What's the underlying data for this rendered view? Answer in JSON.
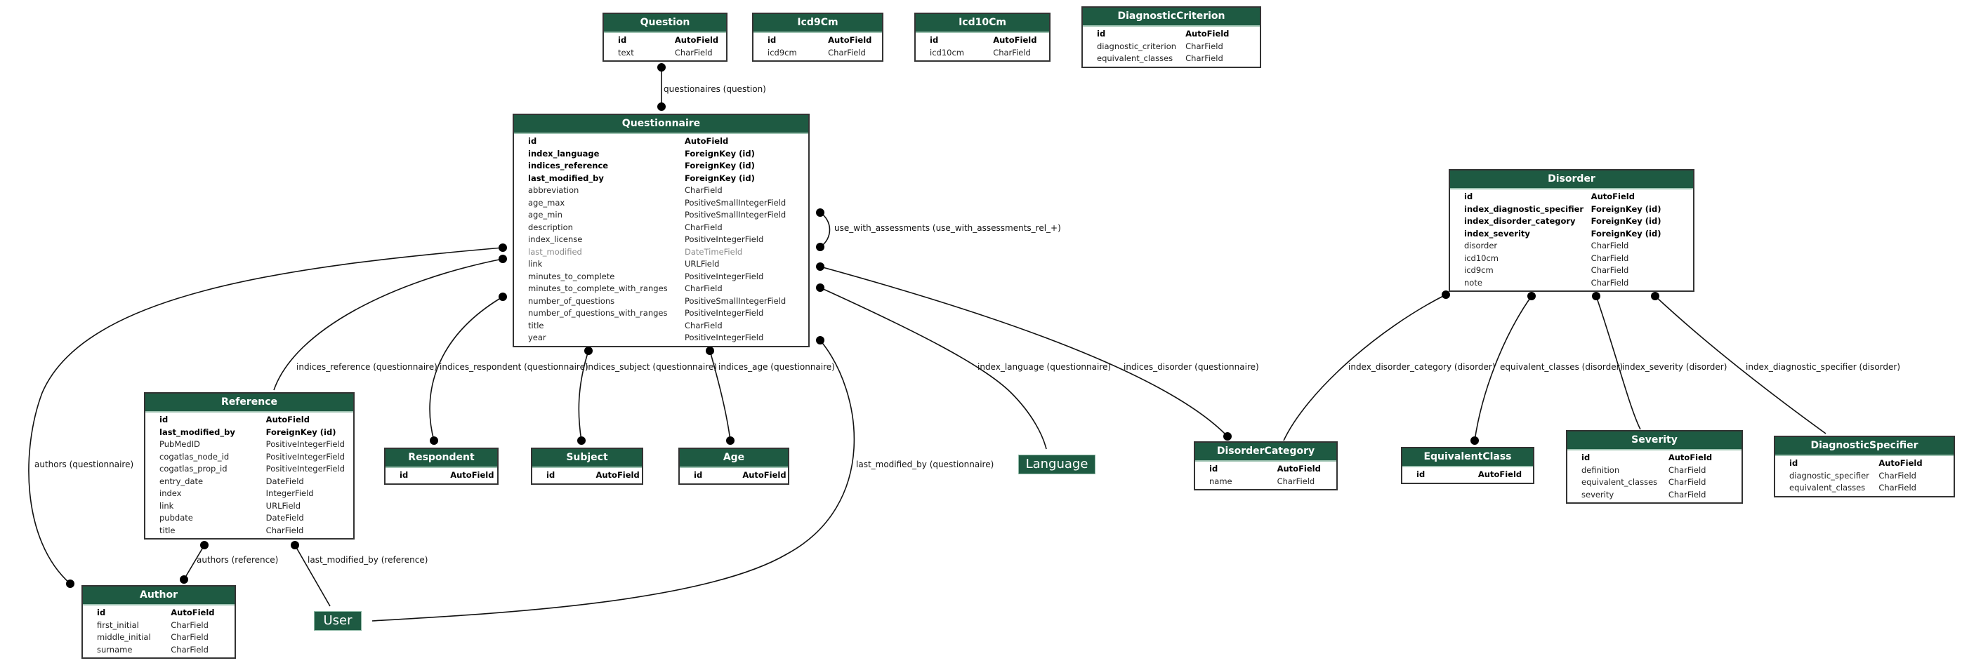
{
  "models": {
    "question": {
      "name": "Question",
      "fields": [
        [
          "id",
          "AutoField",
          "pk"
        ],
        [
          "text",
          "CharField",
          ""
        ]
      ]
    },
    "icd9cm": {
      "name": "Icd9Cm",
      "fields": [
        [
          "id",
          "AutoField",
          "pk"
        ],
        [
          "icd9cm",
          "CharField",
          ""
        ]
      ]
    },
    "icd10cm": {
      "name": "Icd10Cm",
      "fields": [
        [
          "id",
          "AutoField",
          "pk"
        ],
        [
          "icd10cm",
          "CharField",
          ""
        ]
      ]
    },
    "diagnosticcriterion": {
      "name": "DiagnosticCriterion",
      "fields": [
        [
          "id",
          "AutoField",
          "pk"
        ],
        [
          "diagnostic_criterion",
          "CharField",
          ""
        ],
        [
          "equivalent_classes",
          "CharField",
          ""
        ]
      ]
    },
    "questionnaire": {
      "name": "Questionnaire",
      "fields": [
        [
          "id",
          "AutoField",
          "pk"
        ],
        [
          "index_language",
          "ForeignKey (id)",
          "fk"
        ],
        [
          "indices_reference",
          "ForeignKey (id)",
          "fk"
        ],
        [
          "last_modified_by",
          "ForeignKey (id)",
          "fk"
        ],
        [
          "abbreviation",
          "CharField",
          ""
        ],
        [
          "age_max",
          "PositiveSmallIntegerField",
          ""
        ],
        [
          "age_min",
          "PositiveSmallIntegerField",
          ""
        ],
        [
          "description",
          "CharField",
          ""
        ],
        [
          "index_license",
          "PositiveIntegerField",
          ""
        ],
        [
          "last_modified",
          "DateTimeField",
          "muted"
        ],
        [
          "link",
          "URLField",
          ""
        ],
        [
          "minutes_to_complete",
          "PositiveIntegerField",
          ""
        ],
        [
          "minutes_to_complete_with_ranges",
          "CharField",
          ""
        ],
        [
          "number_of_questions",
          "PositiveSmallIntegerField",
          ""
        ],
        [
          "number_of_questions_with_ranges",
          "PositiveIntegerField",
          ""
        ],
        [
          "title",
          "CharField",
          ""
        ],
        [
          "year",
          "PositiveIntegerField",
          ""
        ]
      ]
    },
    "disorder": {
      "name": "Disorder",
      "fields": [
        [
          "id",
          "AutoField",
          "pk"
        ],
        [
          "index_diagnostic_specifier",
          "ForeignKey (id)",
          "fk"
        ],
        [
          "index_disorder_category",
          "ForeignKey (id)",
          "fk"
        ],
        [
          "index_severity",
          "ForeignKey (id)",
          "fk"
        ],
        [
          "disorder",
          "CharField",
          ""
        ],
        [
          "icd10cm",
          "CharField",
          ""
        ],
        [
          "icd9cm",
          "CharField",
          ""
        ],
        [
          "note",
          "CharField",
          ""
        ]
      ]
    },
    "reference": {
      "name": "Reference",
      "fields": [
        [
          "id",
          "AutoField",
          "pk"
        ],
        [
          "last_modified_by",
          "ForeignKey (id)",
          "fk"
        ],
        [
          "PubMedID",
          "PositiveIntegerField",
          ""
        ],
        [
          "cogatlas_node_id",
          "PositiveIntegerField",
          ""
        ],
        [
          "cogatlas_prop_id",
          "PositiveIntegerField",
          ""
        ],
        [
          "entry_date",
          "DateField",
          ""
        ],
        [
          "index",
          "IntegerField",
          ""
        ],
        [
          "link",
          "URLField",
          ""
        ],
        [
          "pubdate",
          "DateField",
          ""
        ],
        [
          "title",
          "CharField",
          ""
        ]
      ]
    },
    "respondent": {
      "name": "Respondent",
      "fields": [
        [
          "id",
          "AutoField",
          "pk"
        ]
      ]
    },
    "subject": {
      "name": "Subject",
      "fields": [
        [
          "id",
          "AutoField",
          "pk"
        ]
      ]
    },
    "age": {
      "name": "Age",
      "fields": [
        [
          "id",
          "AutoField",
          "pk"
        ]
      ]
    },
    "disordercategory": {
      "name": "DisorderCategory",
      "fields": [
        [
          "id",
          "AutoField",
          "pk"
        ],
        [
          "name",
          "CharField",
          ""
        ]
      ]
    },
    "equivalentclass": {
      "name": "EquivalentClass",
      "fields": [
        [
          "id",
          "AutoField",
          "pk"
        ]
      ]
    },
    "severity": {
      "name": "Severity",
      "fields": [
        [
          "id",
          "AutoField",
          "pk"
        ],
        [
          "definition",
          "CharField",
          ""
        ],
        [
          "equivalent_classes",
          "CharField",
          ""
        ],
        [
          "severity",
          "CharField",
          ""
        ]
      ]
    },
    "diagnosticspecifier": {
      "name": "DiagnosticSpecifier",
      "fields": [
        [
          "id",
          "AutoField",
          "pk"
        ],
        [
          "diagnostic_specifier",
          "CharField",
          ""
        ],
        [
          "equivalent_classes",
          "CharField",
          ""
        ]
      ]
    },
    "author": {
      "name": "Author",
      "fields": [
        [
          "id",
          "AutoField",
          "pk"
        ],
        [
          "first_initial",
          "CharField",
          ""
        ],
        [
          "middle_initial",
          "CharField",
          ""
        ],
        [
          "surname",
          "CharField",
          ""
        ]
      ]
    }
  },
  "external": {
    "language": "Language",
    "user": "User"
  },
  "relations": {
    "questionaires_question": "questionaires (question)",
    "use_with_assessments": "use_with_assessments (use_with_assessments_rel_+)",
    "indices_reference": "indices_reference (questionnaire)",
    "indices_respondent": "indices_respondent (questionnaire)",
    "indices_subject": "indices_subject (questionnaire)",
    "indices_age": "indices_age (questionnaire)",
    "index_language": "index_language (questionnaire)",
    "indices_disorder": "indices_disorder (questionnaire)",
    "index_disorder_category": "index_disorder_category (disorder)",
    "equivalent_classes": "equivalent_classes (disorder)",
    "index_severity": "index_severity (disorder)",
    "index_diagnostic_specifier": "index_diagnostic_specifier (disorder)",
    "authors_questionnaire": "authors (questionnaire)",
    "last_modified_by_questionnaire": "last_modified_by (questionnaire)",
    "authors_reference": "authors (reference)",
    "last_modified_by_reference": "last_modified_by (reference)"
  }
}
